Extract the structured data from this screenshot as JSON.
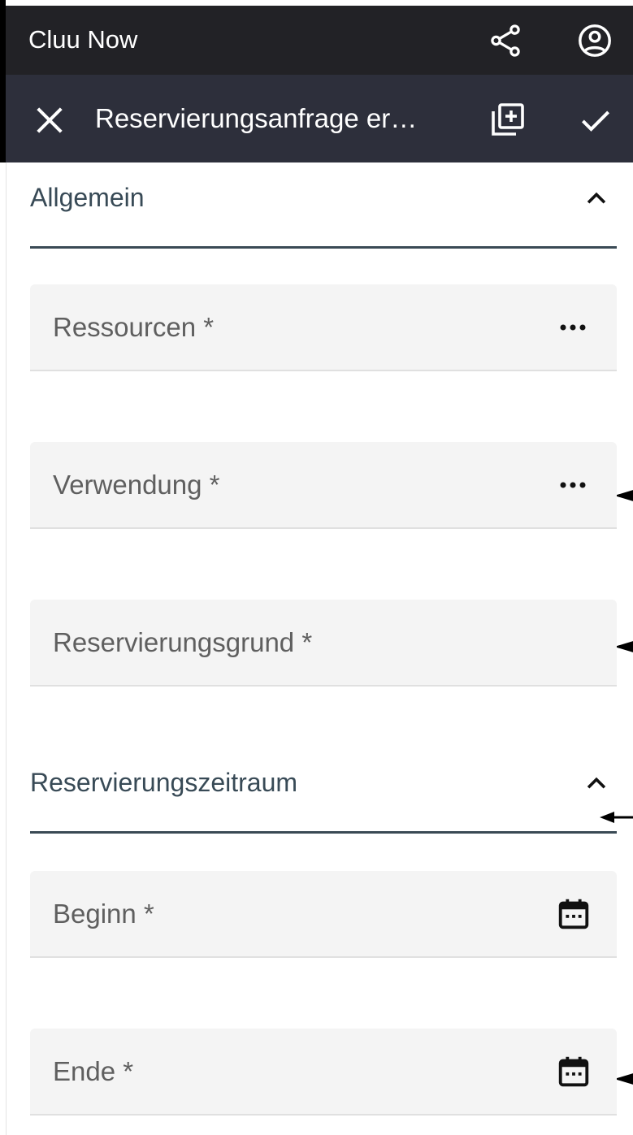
{
  "app": {
    "title": "Cluu Now"
  },
  "appbar": {
    "icons": [
      "share-icon",
      "account-circle-icon"
    ]
  },
  "toolbar": {
    "title": "Reservierungsanfrage er…",
    "icons": [
      "close-icon",
      "library-add-icon",
      "check-icon"
    ]
  },
  "sections": [
    {
      "title": "Allgemein",
      "fields": [
        {
          "label": "Ressourcen *",
          "icon": "more-horizontal-icon"
        },
        {
          "label": "Verwendung *",
          "icon": "more-horizontal-icon"
        },
        {
          "label": "Reservierungsgrund *",
          "icon": ""
        }
      ]
    },
    {
      "title": "Reservierungszeitraum",
      "fields": [
        {
          "label": "Beginn *",
          "icon": "calendar-icon"
        },
        {
          "label": "Ende *",
          "icon": "calendar-icon"
        }
      ]
    }
  ],
  "colors": {
    "appbar": "#222226",
    "toolbar": "#2d2f3b",
    "section_title": "#384a56",
    "field_background": "#f4f4f4"
  }
}
